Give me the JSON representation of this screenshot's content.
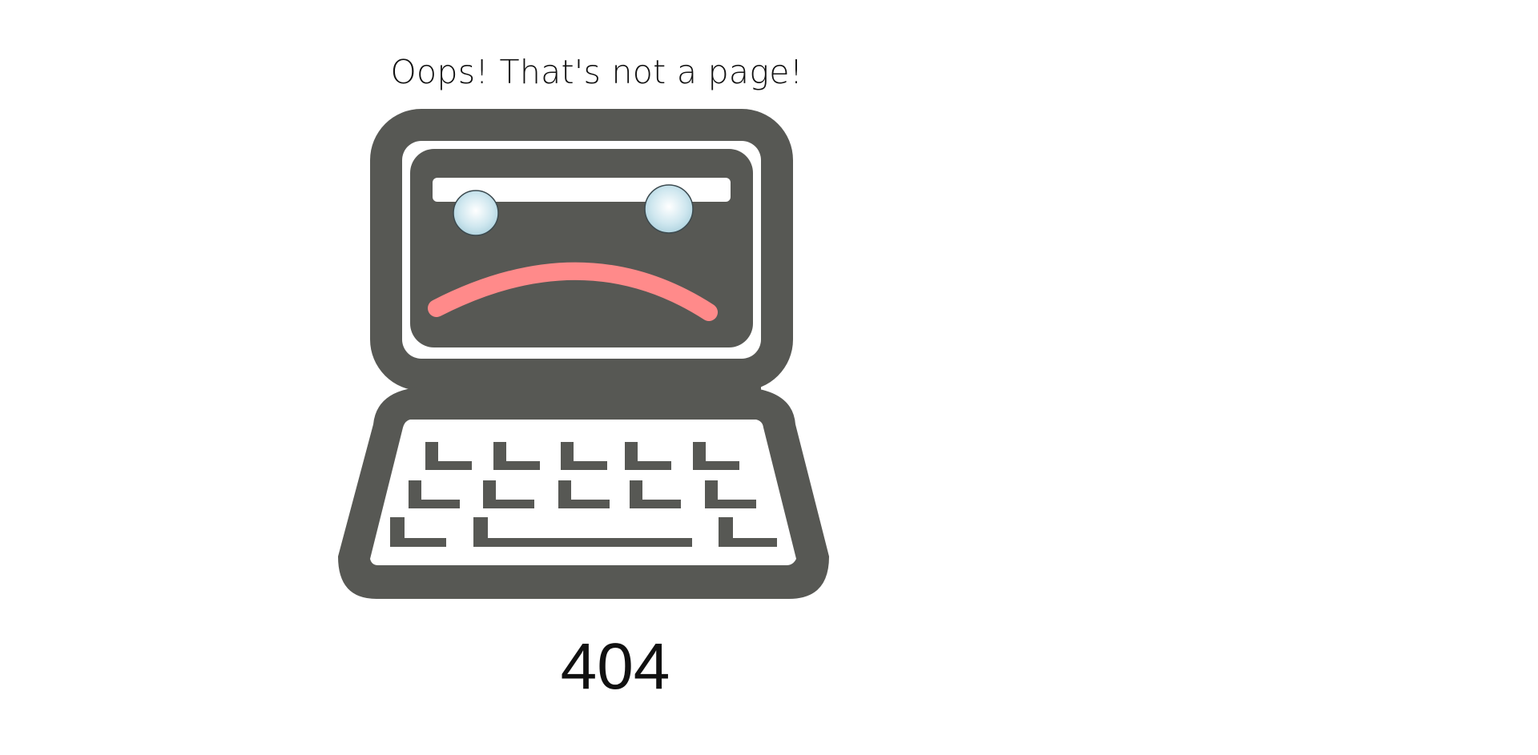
{
  "error": {
    "message": "Oops! That's not a page!",
    "code": "404"
  },
  "illustration": {
    "icon": "sad-computer-icon",
    "colors": {
      "body": "#575854",
      "screen_frame": "#ffffff",
      "mouth": "#ff8a8a",
      "eyes": "#cfe7ef"
    }
  }
}
